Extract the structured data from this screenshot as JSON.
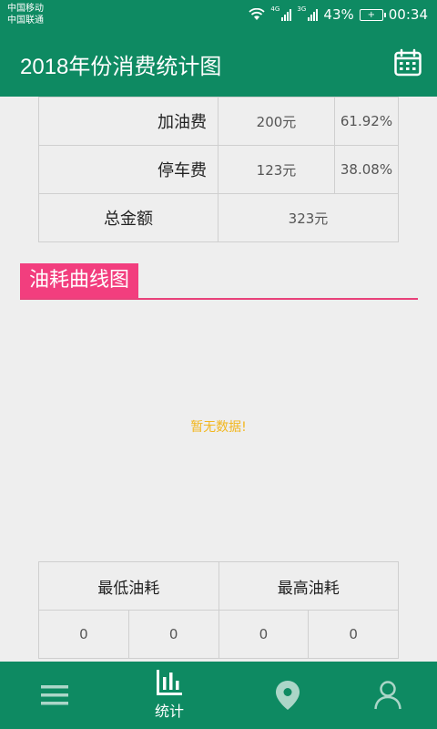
{
  "status_bar": {
    "carrier_1": "中国移动",
    "carrier_2": "中国联通",
    "network_1": "4G",
    "network_2": "3G",
    "battery": "43%",
    "time": "00:34"
  },
  "app_bar": {
    "title": "2018年份消费统计图",
    "calendar_icon": "calendar-icon"
  },
  "cost_table": {
    "rows": [
      {
        "label": "加油费",
        "amount": "200元",
        "percent": "61.92%"
      },
      {
        "label": "停车费",
        "amount": "123元",
        "percent": "38.08%"
      }
    ],
    "total_label": "总金额",
    "total_value": "323元"
  },
  "fuel_section": {
    "title": "油耗曲线图",
    "empty_message": "暂无数据!"
  },
  "fuel_table": {
    "min_header": "最低油耗",
    "max_header": "最高油耗",
    "values": [
      "0",
      "0",
      "0",
      "0"
    ]
  },
  "bottom_nav": {
    "items": [
      {
        "icon": "menu-icon",
        "label": ""
      },
      {
        "icon": "bar-chart-icon",
        "label": "统计"
      },
      {
        "icon": "location-pin-icon",
        "label": ""
      },
      {
        "icon": "user-icon",
        "label": ""
      }
    ]
  },
  "colors": {
    "primary": "#0e8a62",
    "accent": "#f23e7e",
    "empty_text": "#f2b71f",
    "background": "#eeeeee"
  }
}
